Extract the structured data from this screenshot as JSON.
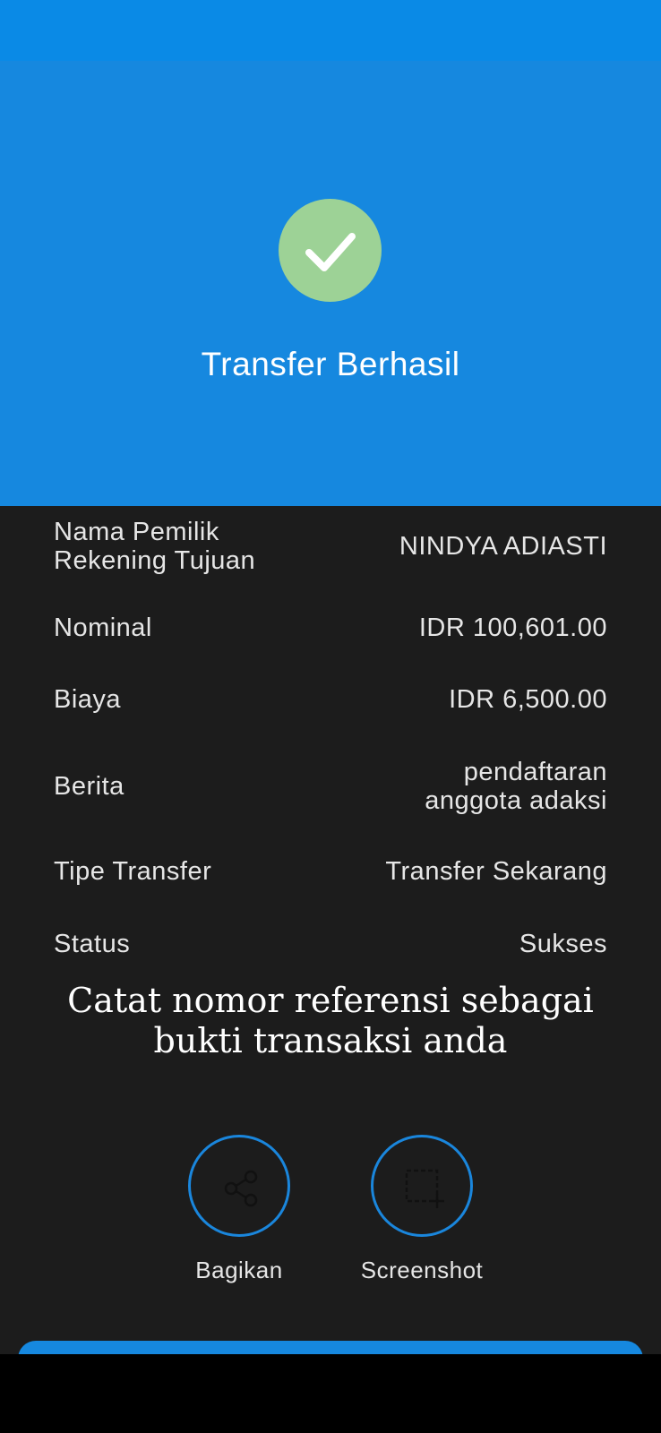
{
  "header": {
    "title": "Transfer Berhasil",
    "icon": "checkmark-circle-icon",
    "accent_color": "#1688df",
    "success_color": "#9dd296"
  },
  "details": {
    "rows": [
      {
        "label": "Nama Pemilik Rekening Tujuan",
        "value": "NINDYA ADIASTI"
      },
      {
        "label": "Nominal",
        "value": "IDR 100,601.00"
      },
      {
        "label": "Biaya",
        "value": "IDR 6,500.00"
      },
      {
        "label": "Berita",
        "value": "pendaftaran anggota adaksi"
      },
      {
        "label": "Tipe Transfer",
        "value": "Transfer Sekarang"
      },
      {
        "label": "Status",
        "value": "Sukses"
      }
    ]
  },
  "note": "Catat nomor referensi sebagai bukti transaksi anda",
  "actions": {
    "share": {
      "label": "Bagikan",
      "icon": "share-icon"
    },
    "screenshot": {
      "label": "Screenshot",
      "icon": "screenshot-icon"
    }
  }
}
